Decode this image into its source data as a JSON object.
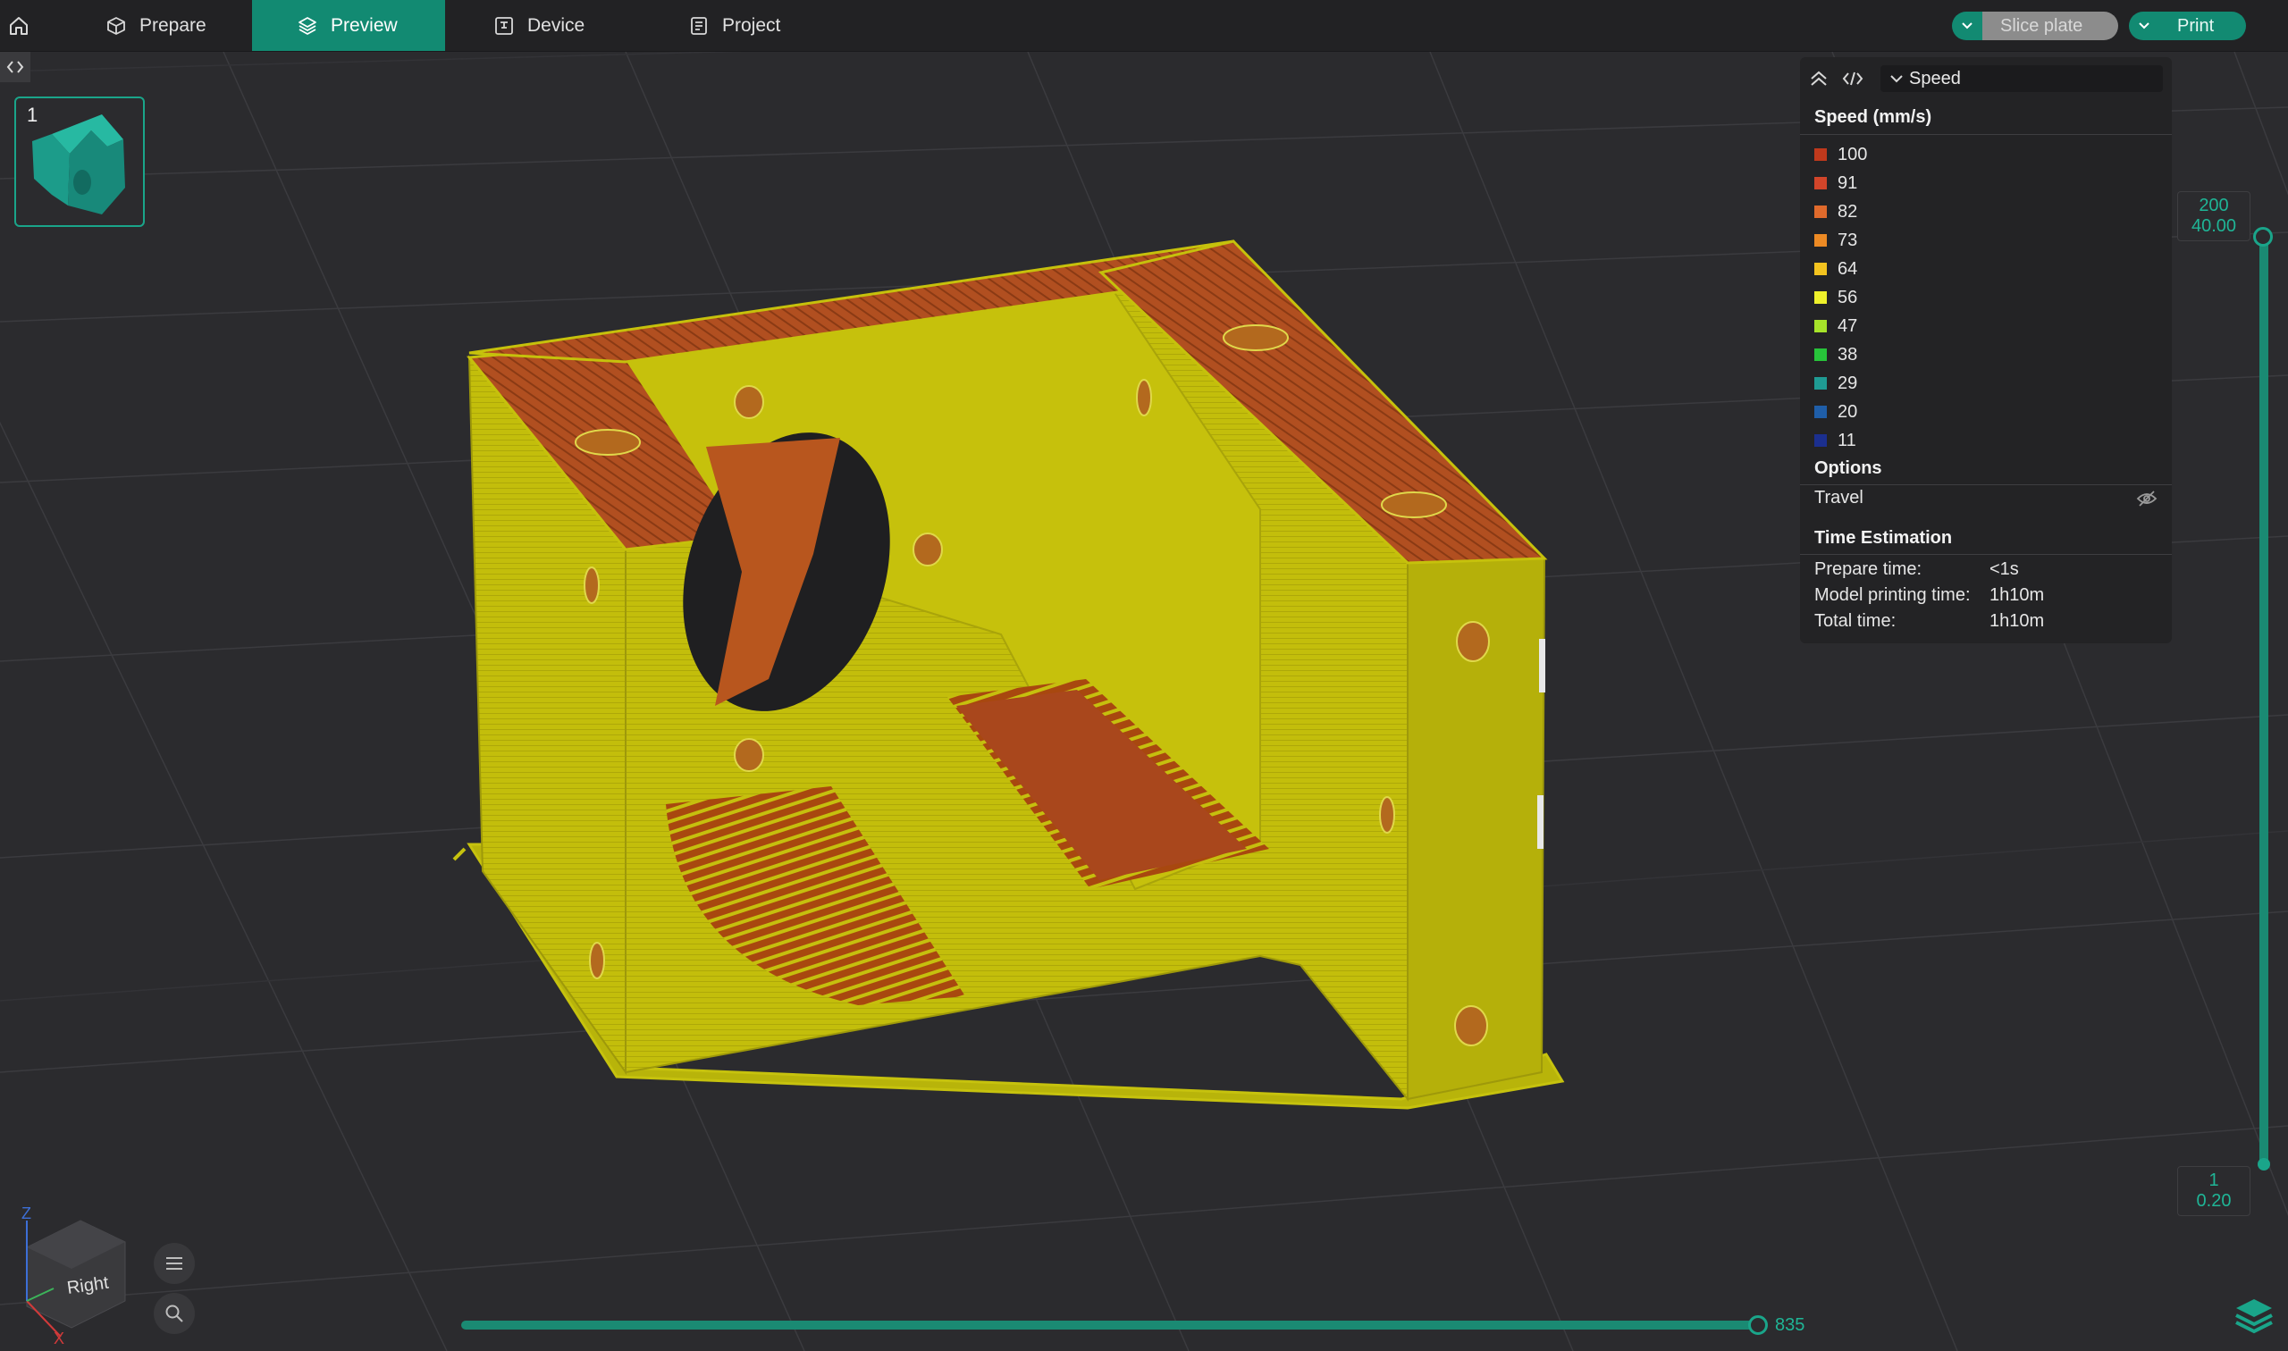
{
  "topbar": {
    "tabs": [
      {
        "label": "Prepare",
        "active": false
      },
      {
        "label": "Preview",
        "active": true
      },
      {
        "label": "Device",
        "active": false
      },
      {
        "label": "Project",
        "active": false
      }
    ],
    "slice_label": "Slice plate",
    "print_label": "Print"
  },
  "plate": {
    "number": "1"
  },
  "legend": {
    "view_mode": "Speed",
    "speed_title": "Speed (mm/s)",
    "speed_items": [
      {
        "value": "100",
        "color": "#c0391c"
      },
      {
        "value": "91",
        "color": "#d2452a"
      },
      {
        "value": "82",
        "color": "#e06a2c"
      },
      {
        "value": "73",
        "color": "#ed8a24"
      },
      {
        "value": "64",
        "color": "#f3c31f"
      },
      {
        "value": "56",
        "color": "#eef02b"
      },
      {
        "value": "47",
        "color": "#a6e32a"
      },
      {
        "value": "38",
        "color": "#27c43a"
      },
      {
        "value": "29",
        "color": "#1f9b93"
      },
      {
        "value": "20",
        "color": "#1f5ea8"
      },
      {
        "value": "11",
        "color": "#1b2f8f"
      }
    ],
    "options_title": "Options",
    "travel_label": "Travel",
    "time_title": "Time Estimation",
    "prepare_time_label": "Prepare time:",
    "prepare_time_value": "<1s",
    "model_time_label": "Model printing time:",
    "model_time_value": "1h10m",
    "total_time_label": "Total time:",
    "total_time_value": "1h10m"
  },
  "layer_slider": {
    "top_layer": "200",
    "top_height": "40.00",
    "bottom_layer": "1",
    "bottom_height": "0.20"
  },
  "move_slider": {
    "value": "835"
  },
  "view_cube": {
    "face_label": "Right",
    "axis_z": "Z",
    "axis_x": "X"
  },
  "colors": {
    "accent": "#128a72",
    "model_yellow": "#c2bd0a",
    "model_rust": "#b1501f",
    "background": "#2b2b2e"
  }
}
